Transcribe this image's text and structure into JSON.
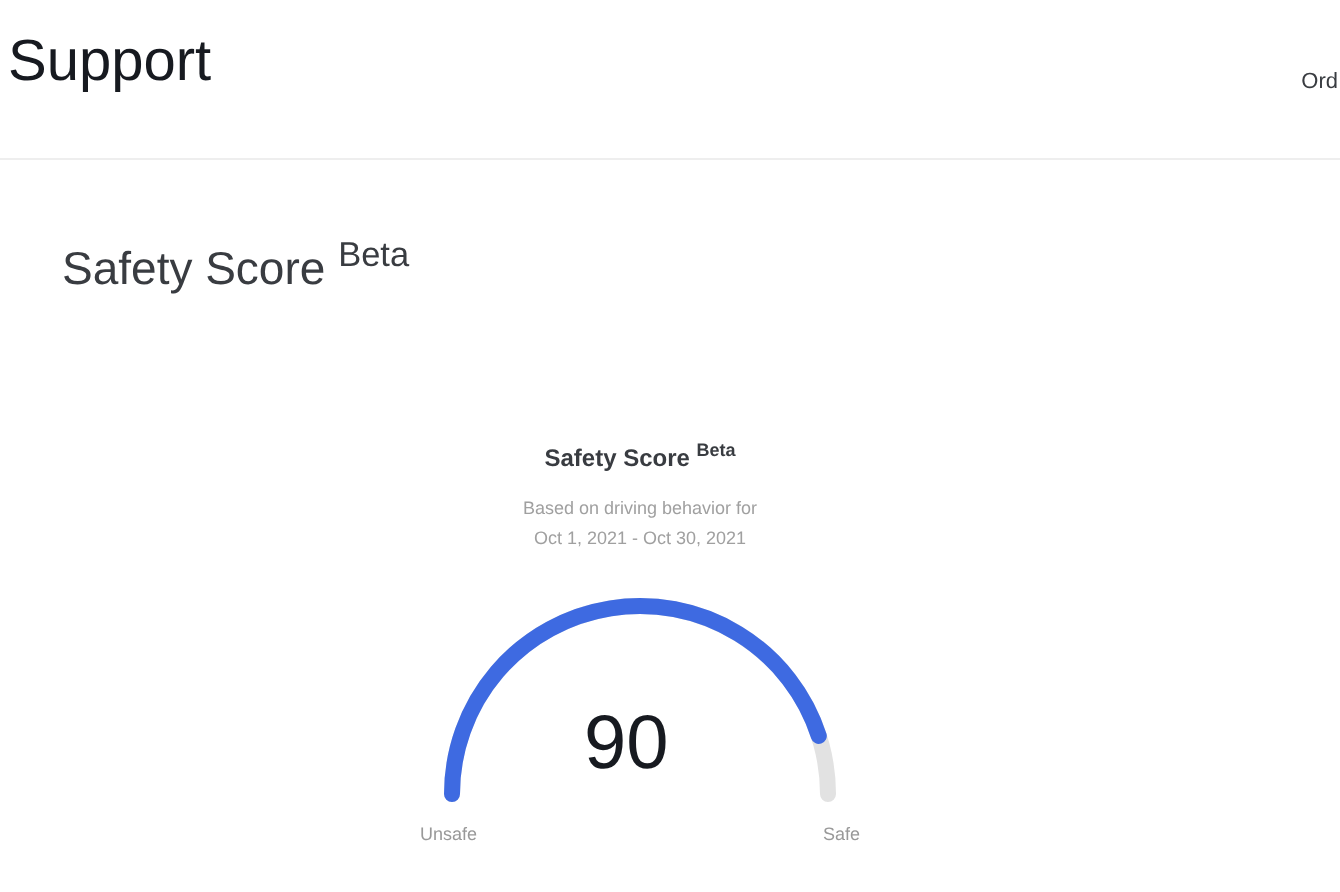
{
  "header": {
    "title": "Support",
    "nav_item": "Ord"
  },
  "page_title": "Safety Score $^{Beta}$",
  "card": {
    "title": "Safety Score $^{Beta}$",
    "subtitle": "Based on driving behavior for",
    "period": "Oct 1, 2021 - Oct 30, 2021",
    "gauge": {
      "score": "90",
      "min_label": "Unsafe",
      "max_label": "Safe"
    }
  }
}
